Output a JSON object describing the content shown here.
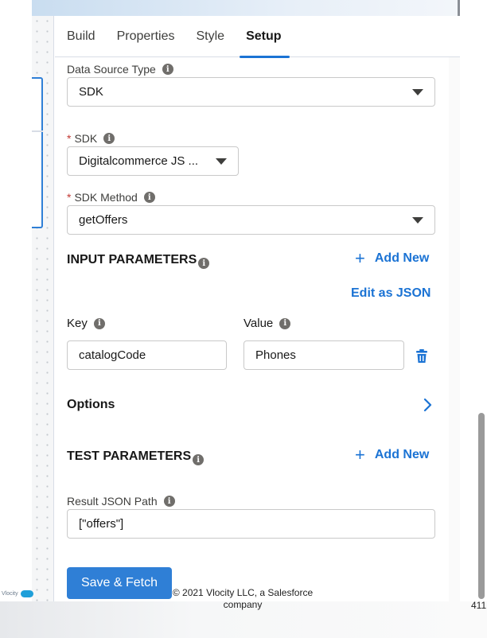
{
  "tabs": [
    {
      "label": "Build"
    },
    {
      "label": "Properties"
    },
    {
      "label": "Style"
    },
    {
      "label": "Setup",
      "active": true
    }
  ],
  "data_source_type": {
    "label": "Data Source Type",
    "value": "SDK"
  },
  "sdk": {
    "required_mark": "*",
    "label": "SDK",
    "value": "Digitalcommerce JS ..."
  },
  "sdk_method": {
    "required_mark": "*",
    "label": "SDK Method",
    "value": "getOffers"
  },
  "input_parameters": {
    "title": "INPUT PARAMETERS",
    "add_label": "Add New",
    "add_symbol": "+",
    "edit_json_label": "Edit as JSON",
    "key_header": "Key",
    "value_header": "Value",
    "rows": [
      {
        "key": "catalogCode",
        "value": "Phones"
      }
    ]
  },
  "options": {
    "title": "Options",
    "chevron": ">"
  },
  "test_parameters": {
    "title": "TEST PARAMETERS",
    "add_label": "Add New",
    "add_symbol": "+"
  },
  "result_json_path": {
    "label": "Result JSON Path",
    "value": "[\"offers\"]"
  },
  "save_fetch_label": "Save & Fetch",
  "footer": {
    "copyright_line1": "© 2021 Vlocity LLC, a Salesforce",
    "copyright_line2": "company",
    "page_number": "411",
    "logo_text": "Vlocity"
  },
  "colors": {
    "accent": "#1b73d4",
    "button": "#2f7fd6",
    "required": "#c23934",
    "delete_icon": "#1b73d4"
  },
  "icons": [
    "info-icon",
    "caret-down-icon",
    "plus-icon",
    "trash-icon",
    "chevron-right-icon"
  ]
}
